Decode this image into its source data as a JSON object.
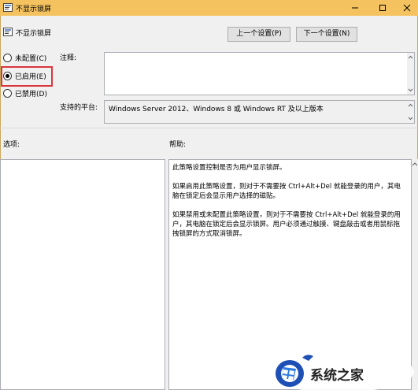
{
  "window": {
    "title": "不显示锁屏",
    "accent": "#f4c25e"
  },
  "header": {
    "title": "不显示锁屏"
  },
  "nav": {
    "prev_label": "上一个设置(P)",
    "next_label": "下一个设置(N)"
  },
  "radios": [
    {
      "label": "未配置(C)",
      "checked": false
    },
    {
      "label": "已启用(E)",
      "checked": true
    },
    {
      "label": "已禁用(D)",
      "checked": false
    }
  ],
  "comment": {
    "label": "注释:",
    "value": ""
  },
  "platform": {
    "label": "支持的平台:",
    "value": "Windows Server 2012、Windows 8 或 Windows RT 及以上版本"
  },
  "options": {
    "label": "选项:"
  },
  "help": {
    "label": "帮助:",
    "paragraphs": [
      "此策略设置控制是否为用户显示锁屏。",
      "如果启用此策略设置，则对于不需要按 Ctrl+Alt+Del 就能登录的用户，其电脑在锁定后会显示用户选择的磁贴。",
      "如果禁用或未配置此策略设置，则对于不需要按 Ctrl+Alt+Del 就能登录的用户，其电脑在锁定后会显示锁屏。用户必须通过触摸、键盘敲击或者用鼠标拖拽锁屏的方式取消锁屏。"
    ]
  },
  "watermark": {
    "text": "系统之家"
  }
}
